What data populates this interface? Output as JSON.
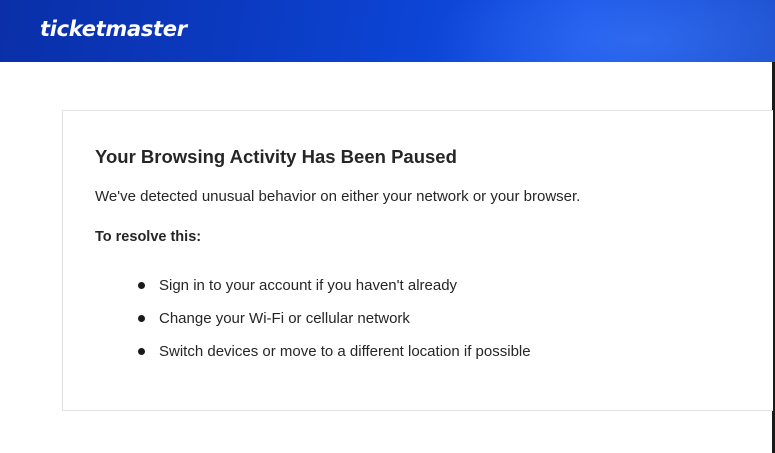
{
  "header": {
    "logo_text": "ticketmaster",
    "colors": {
      "brand_blue": "#0b3cc4"
    }
  },
  "card": {
    "title": "Your Browsing Activity Has Been Paused",
    "description": "We've detected unusual behavior on either your network or your browser.",
    "resolve_heading": "To resolve this:",
    "steps": [
      "Sign in to your account if you haven't already",
      "Change your Wi-Fi or cellular network",
      "Switch devices or move to a different location if possible"
    ]
  }
}
